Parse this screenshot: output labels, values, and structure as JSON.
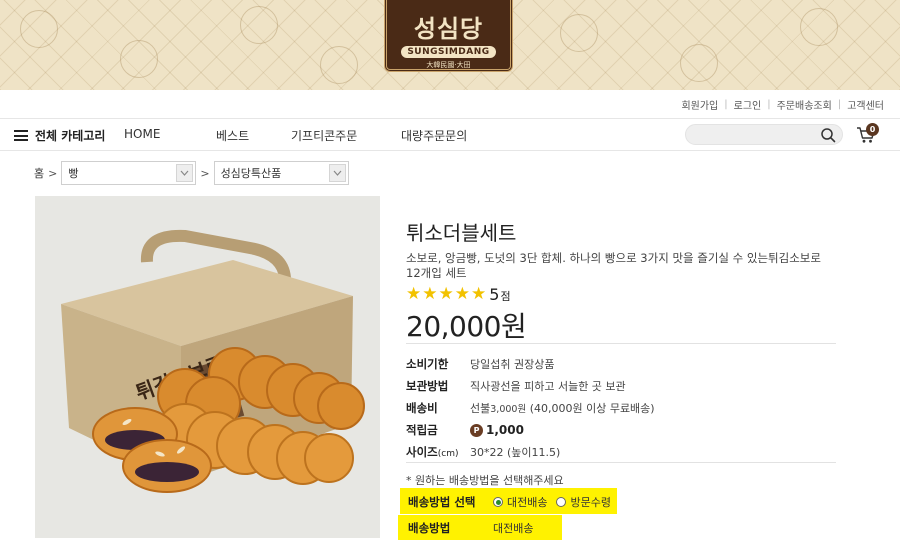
{
  "brand": {
    "name": "성심당",
    "romanized": "SUNGSIMDANG",
    "tagline": "大韓民國·大田"
  },
  "utility_links": [
    "회원가입",
    "로그인",
    "주문배송조회",
    "고객센터"
  ],
  "nav": {
    "category_label": "전체 카테고리",
    "items": [
      "HOME",
      "베스트",
      "기프티콘주문",
      "대량주문문의"
    ],
    "search": {
      "value": "",
      "placeholder": ""
    },
    "cart_count": "0"
  },
  "breadcrumb": {
    "home": "홈",
    "level1": "빵",
    "level2": "성심당특산품"
  },
  "product": {
    "title": "튀소더블세트",
    "description": "소보로, 앙금빵, 도넛의 3단 합체. 하나의 빵으로 3가지 맛을 즐기실 수 있는튀김소보로 12개입 세트",
    "rating_stars": 5,
    "rating_value": "5",
    "rating_unit": "점",
    "price": "20,000원",
    "specs": {
      "expiry_label": "소비기한",
      "expiry_value": "당일섭취 권장상품",
      "storage_label": "보관방법",
      "storage_value": "직사광선을 피하고 서늘한 곳 보관",
      "shipping_fee_label": "배송비",
      "shipping_fee_prefix": "선불",
      "shipping_fee_amount": "3,000원",
      "shipping_fee_note": "(40,000원 이상 무료배송)",
      "points_label": "적립금",
      "points_icon": "P",
      "points_value": "1,000",
      "size_label": "사이즈",
      "size_unit": "(cm)",
      "size_value": "30*22 (높이11.5)"
    },
    "image_box_text": "튀김소보로"
  },
  "shipping": {
    "note": "* 원하는 배송방법을 선택해주세요",
    "method_select_label": "배송방법 선택",
    "options": [
      "대전배송",
      "방문수령"
    ],
    "selected_option": "대전배송",
    "method_label": "배송방법",
    "method_value": "대전배송"
  },
  "colors": {
    "highlight": "#fff200",
    "star": "#f2c200",
    "brand_brown": "#4a2a16",
    "radio_selected": "#2a8a2a"
  }
}
